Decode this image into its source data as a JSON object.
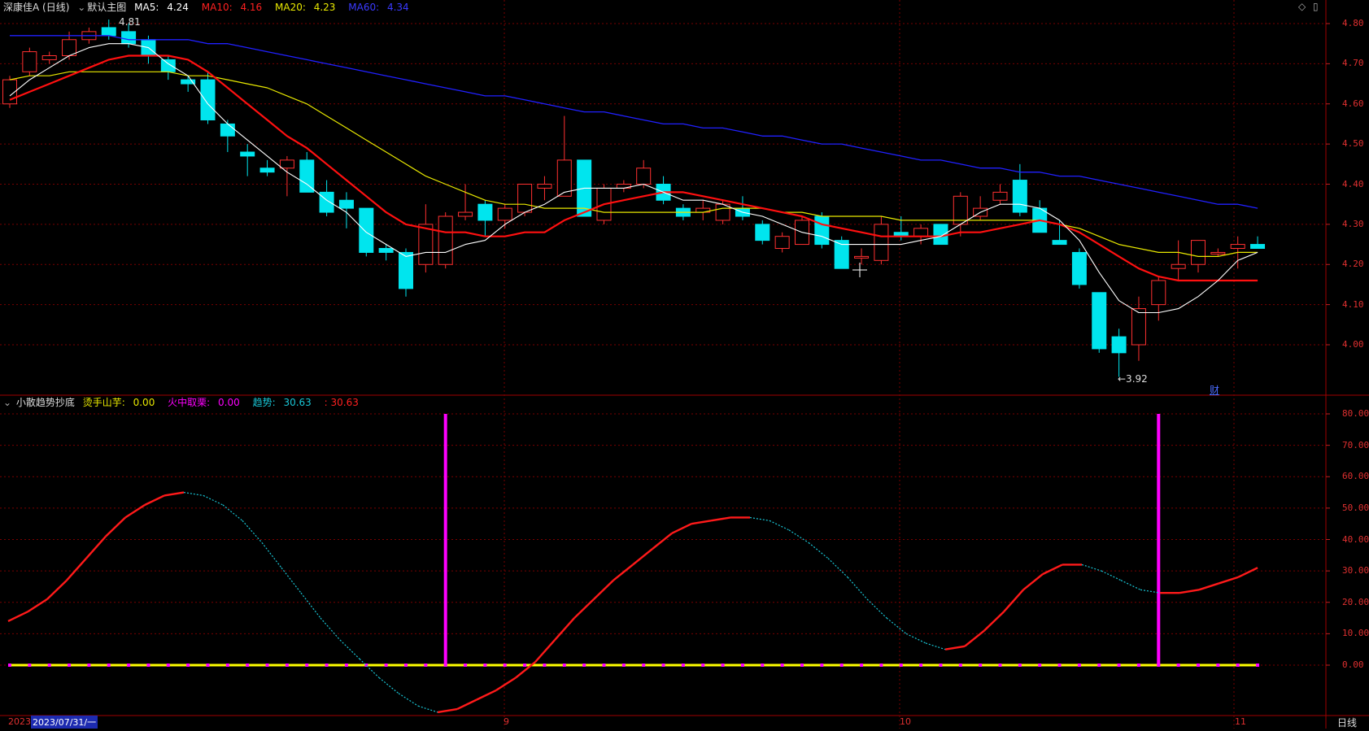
{
  "main_pane": {
    "stock_name": "深康佳A (日线)",
    "template_label": "默认主图",
    "ma5_label": "MA5:",
    "ma5_value": "4.24",
    "ma10_label": "MA10:",
    "ma10_value": "4.16",
    "ma20_label": "MA20:",
    "ma20_value": "4.23",
    "ma60_label": "MA60:",
    "ma60_value": "4.34",
    "high_marker": "4.81",
    "low_marker": "←3.92",
    "fin_badge": "财",
    "price_ticks": [
      "4.80",
      "4.70",
      "4.60",
      "4.50",
      "4.40",
      "4.30",
      "4.20",
      "4.10",
      "4.00"
    ]
  },
  "indicator_pane": {
    "name": "小散趋势抄底",
    "l1_label": "烫手山芋:",
    "l1_value": "0.00",
    "l2_label": "火中取栗:",
    "l2_value": "0.00",
    "l3_label": "趋势:",
    "l3_value": "30.63",
    "l4_value": ": 30.63",
    "ticks": [
      "80.00",
      "70.00",
      "60.00",
      "50.00",
      "40.00",
      "30.00",
      "20.00",
      "10.00",
      "0.00"
    ]
  },
  "time_axis": {
    "year_fragment": "2023",
    "cursor_date": "2023/07/31/一",
    "month_labels": [
      "9",
      "10",
      "11"
    ],
    "period": "日线"
  },
  "colors": {
    "bull": "#ff3030",
    "bear": "#00e5ee",
    "ma5": "#ffffff",
    "ma10": "#ff1010",
    "ma20": "#e8e800",
    "ma60": "#2020ff",
    "trend_up": "#ff1a1a",
    "trend_down": "#19c6d6",
    "signal_bar": "#ff00ff",
    "zero_line": "#ffff00",
    "grid": "#7a0000"
  },
  "chart_data": [
    {
      "type": "candlestick",
      "title": "深康佳A (日线)",
      "ylim": [
        3.92,
        4.81
      ],
      "ticks": [
        4.8,
        4.7,
        4.6,
        4.5,
        4.4,
        4.3,
        4.2,
        4.1,
        4.0
      ],
      "candles": [
        [
          4.6,
          4.67,
          4.59,
          4.66
        ],
        [
          4.68,
          4.74,
          4.67,
          4.73
        ],
        [
          4.71,
          4.73,
          4.7,
          4.72
        ],
        [
          4.72,
          4.78,
          4.71,
          4.76
        ],
        [
          4.76,
          4.79,
          4.75,
          4.78
        ],
        [
          4.79,
          4.81,
          4.76,
          4.77
        ],
        [
          4.78,
          4.8,
          4.74,
          4.75
        ],
        [
          4.76,
          4.77,
          4.7,
          4.72
        ],
        [
          4.71,
          4.72,
          4.66,
          4.68
        ],
        [
          4.66,
          4.67,
          4.63,
          4.65
        ],
        [
          4.66,
          4.68,
          4.55,
          4.56
        ],
        [
          4.55,
          4.56,
          4.48,
          4.52
        ],
        [
          4.48,
          4.5,
          4.42,
          4.47
        ],
        [
          4.44,
          4.46,
          4.42,
          4.43
        ],
        [
          4.44,
          4.47,
          4.37,
          4.46
        ],
        [
          4.46,
          4.48,
          4.38,
          4.38
        ],
        [
          4.38,
          4.41,
          4.32,
          4.33
        ],
        [
          4.36,
          4.38,
          4.29,
          4.34
        ],
        [
          4.34,
          4.34,
          4.22,
          4.23
        ],
        [
          4.24,
          4.25,
          4.21,
          4.23
        ],
        [
          4.23,
          4.24,
          4.12,
          4.14
        ],
        [
          4.2,
          4.35,
          4.18,
          4.3
        ],
        [
          4.2,
          4.33,
          4.19,
          4.32
        ],
        [
          4.32,
          4.4,
          4.31,
          4.33
        ],
        [
          4.35,
          4.36,
          4.27,
          4.31
        ],
        [
          4.31,
          4.35,
          4.29,
          4.34
        ],
        [
          4.33,
          4.4,
          4.32,
          4.4
        ],
        [
          4.39,
          4.42,
          4.36,
          4.4
        ],
        [
          4.37,
          4.57,
          4.37,
          4.46
        ],
        [
          4.46,
          4.46,
          4.32,
          4.32
        ],
        [
          4.31,
          4.4,
          4.3,
          4.39
        ],
        [
          4.39,
          4.41,
          4.38,
          4.4
        ],
        [
          4.4,
          4.46,
          4.39,
          4.44
        ],
        [
          4.4,
          4.42,
          4.35,
          4.36
        ],
        [
          4.34,
          4.35,
          4.31,
          4.32
        ],
        [
          4.33,
          4.36,
          4.31,
          4.34
        ],
        [
          4.31,
          4.36,
          4.3,
          4.35
        ],
        [
          4.34,
          4.37,
          4.31,
          4.32
        ],
        [
          4.3,
          4.31,
          4.25,
          4.26
        ],
        [
          4.24,
          4.28,
          4.23,
          4.27
        ],
        [
          4.25,
          4.32,
          4.25,
          4.31
        ],
        [
          4.32,
          4.33,
          4.24,
          4.25
        ],
        [
          4.26,
          4.27,
          4.19,
          4.19
        ],
        [
          4.22,
          4.24,
          4.2,
          4.22
        ],
        [
          4.21,
          4.32,
          4.2,
          4.3
        ],
        [
          4.28,
          4.32,
          4.26,
          4.27
        ],
        [
          4.27,
          4.3,
          4.25,
          4.29
        ],
        [
          4.3,
          4.3,
          4.25,
          4.25
        ],
        [
          4.3,
          4.38,
          4.27,
          4.37
        ],
        [
          4.32,
          4.37,
          4.31,
          4.34
        ],
        [
          4.36,
          4.4,
          4.35,
          4.38
        ],
        [
          4.41,
          4.45,
          4.32,
          4.33
        ],
        [
          4.34,
          4.36,
          4.28,
          4.28
        ],
        [
          4.26,
          4.31,
          4.25,
          4.25
        ],
        [
          4.23,
          4.24,
          4.14,
          4.15
        ],
        [
          4.13,
          4.13,
          3.98,
          3.99
        ],
        [
          4.02,
          4.04,
          3.92,
          3.98
        ],
        [
          4.0,
          4.12,
          3.96,
          4.09
        ],
        [
          4.1,
          4.17,
          4.06,
          4.16
        ],
        [
          4.19,
          4.26,
          4.16,
          4.2
        ],
        [
          4.2,
          4.26,
          4.18,
          4.26
        ],
        [
          4.23,
          4.24,
          4.22,
          4.23
        ],
        [
          4.24,
          4.27,
          4.19,
          4.25
        ],
        [
          4.25,
          4.27,
          4.24,
          4.24
        ]
      ],
      "ma5": [
        4.62,
        4.66,
        4.69,
        4.72,
        4.74,
        4.75,
        4.75,
        4.74,
        4.7,
        4.67,
        4.6,
        4.55,
        4.51,
        4.47,
        4.43,
        4.4,
        4.36,
        4.33,
        4.28,
        4.25,
        4.22,
        4.23,
        4.23,
        4.25,
        4.26,
        4.3,
        4.33,
        4.35,
        4.38,
        4.39,
        4.39,
        4.39,
        4.4,
        4.38,
        4.36,
        4.36,
        4.35,
        4.33,
        4.32,
        4.3,
        4.28,
        4.27,
        4.25,
        4.25,
        4.25,
        4.25,
        4.26,
        4.27,
        4.3,
        4.33,
        4.35,
        4.35,
        4.34,
        4.31,
        4.26,
        4.18,
        4.11,
        4.08,
        4.08,
        4.09,
        4.12,
        4.16,
        4.21,
        4.23
      ],
      "ma10": [
        4.61,
        4.63,
        4.65,
        4.67,
        4.69,
        4.71,
        4.72,
        4.72,
        4.72,
        4.71,
        4.68,
        4.64,
        4.6,
        4.56,
        4.52,
        4.49,
        4.45,
        4.41,
        4.37,
        4.33,
        4.3,
        4.29,
        4.28,
        4.28,
        4.27,
        4.27,
        4.28,
        4.28,
        4.31,
        4.33,
        4.35,
        4.36,
        4.37,
        4.38,
        4.38,
        4.37,
        4.36,
        4.35,
        4.34,
        4.33,
        4.32,
        4.3,
        4.29,
        4.28,
        4.27,
        4.27,
        4.27,
        4.27,
        4.28,
        4.28,
        4.29,
        4.3,
        4.31,
        4.3,
        4.28,
        4.25,
        4.22,
        4.19,
        4.17,
        4.16,
        4.16,
        4.16,
        4.16,
        4.16
      ],
      "ma20": [
        4.66,
        4.67,
        4.67,
        4.68,
        4.68,
        4.68,
        4.68,
        4.68,
        4.68,
        4.67,
        4.67,
        4.66,
        4.65,
        4.64,
        4.62,
        4.6,
        4.57,
        4.54,
        4.51,
        4.48,
        4.45,
        4.42,
        4.4,
        4.38,
        4.36,
        4.35,
        4.35,
        4.34,
        4.34,
        4.34,
        4.33,
        4.33,
        4.33,
        4.33,
        4.33,
        4.33,
        4.34,
        4.34,
        4.34,
        4.33,
        4.33,
        4.32,
        4.32,
        4.32,
        4.32,
        4.31,
        4.31,
        4.31,
        4.31,
        4.31,
        4.31,
        4.31,
        4.31,
        4.3,
        4.29,
        4.27,
        4.25,
        4.24,
        4.23,
        4.23,
        4.22,
        4.22,
        4.23,
        4.23
      ],
      "ma60": [
        4.77,
        4.77,
        4.77,
        4.77,
        4.77,
        4.77,
        4.76,
        4.76,
        4.76,
        4.76,
        4.75,
        4.75,
        4.74,
        4.73,
        4.72,
        4.71,
        4.7,
        4.69,
        4.68,
        4.67,
        4.66,
        4.65,
        4.64,
        4.63,
        4.62,
        4.62,
        4.61,
        4.6,
        4.59,
        4.58,
        4.58,
        4.57,
        4.56,
        4.55,
        4.55,
        4.54,
        4.54,
        4.53,
        4.52,
        4.52,
        4.51,
        4.5,
        4.5,
        4.49,
        4.48,
        4.47,
        4.46,
        4.46,
        4.45,
        4.44,
        4.44,
        4.43,
        4.43,
        4.42,
        4.42,
        4.41,
        4.4,
        4.39,
        4.38,
        4.37,
        4.36,
        4.35,
        4.35,
        4.34
      ]
    },
    {
      "type": "line",
      "title": "小散趋势抄底",
      "ylim": [
        -15,
        82
      ],
      "ticks": [
        80,
        70,
        60,
        50,
        40,
        30,
        20,
        10,
        0
      ],
      "series": [
        {
          "name": "趋势",
          "values": [
            14,
            17,
            21,
            27,
            34,
            41,
            47,
            51,
            54,
            55,
            54,
            51,
            46,
            39,
            31,
            23,
            15,
            8,
            2,
            -4,
            -9,
            -13,
            -15,
            -14,
            -11,
            -8,
            -4,
            1,
            8,
            15,
            21,
            27,
            32,
            37,
            42,
            45,
            46,
            47,
            47,
            46,
            43,
            39,
            34,
            28,
            21,
            15,
            10,
            7,
            5,
            6,
            11,
            17,
            24,
            29,
            32,
            32,
            30,
            27,
            24,
            23,
            23,
            24,
            26,
            28,
            31
          ]
        },
        {
          "name": "烫手山芋",
          "values": [
            0
          ]
        },
        {
          "name": "火中取栗",
          "values": [
            0
          ]
        }
      ],
      "signal_bars_at_index": [
        22,
        58
      ]
    }
  ]
}
